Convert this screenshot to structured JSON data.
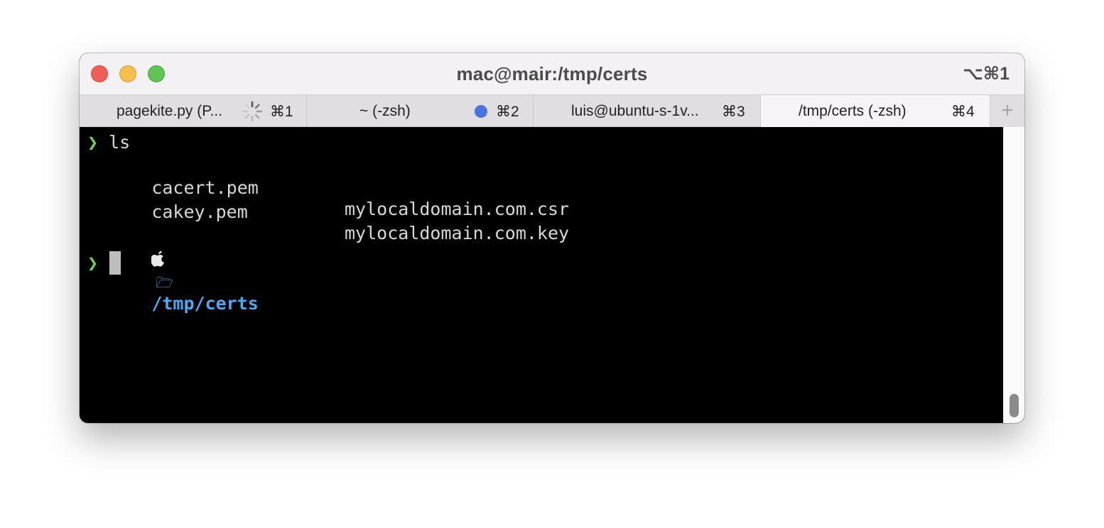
{
  "window": {
    "title": "mac@mair:/tmp/certs",
    "shortcut": "⌥⌘1"
  },
  "tabs": [
    {
      "title": "pagekite.py (P...",
      "shortcut": "⌘1",
      "indicator": "spinner-icon",
      "active": false
    },
    {
      "title": "~ (-zsh)",
      "shortcut": "⌘2",
      "indicator": "activity-dot-icon",
      "active": false
    },
    {
      "title": "luis@ubuntu-s-1v...",
      "shortcut": "⌘3",
      "indicator": "",
      "active": false
    },
    {
      "title": "/tmp/certs (-zsh)",
      "shortcut": "⌘4",
      "indicator": "",
      "active": true
    }
  ],
  "new_tab_label": "+",
  "terminal": {
    "prompt_symbol": "❯",
    "command": "ls",
    "files": [
      [
        "cacert.pem",
        "mylocaldomain.com.csr"
      ],
      [
        "cakey.pem",
        "mylocaldomain.com.key"
      ]
    ],
    "apple_glyph": "",
    "folder_glyph": "🗁",
    "cwd": "/tmp/certs"
  },
  "colors": {
    "prompt_green": "#6cd64f",
    "path_blue": "#4ea8f2",
    "activity_dot": "#4b72e0",
    "close": "#ee5f57",
    "minimize": "#f5be4f",
    "maximize": "#60c353"
  }
}
